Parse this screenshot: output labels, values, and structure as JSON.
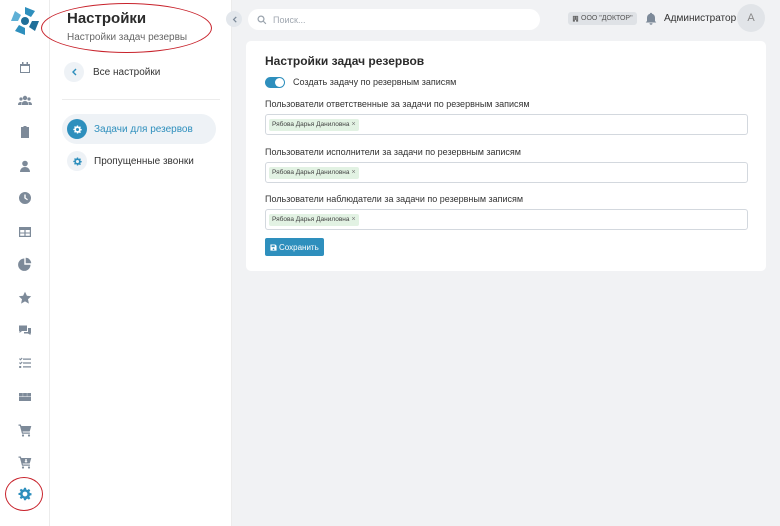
{
  "colors": {
    "accent": "#2e8fbd",
    "annotation": "#c8232c",
    "tag_bg": "#e2f2e3"
  },
  "rail": {
    "icons": [
      "logo-icon",
      "calendar-icon",
      "users-icon",
      "clipboard-icon",
      "user-icon",
      "clock-icon",
      "table-icon",
      "pie-chart-icon",
      "star-icon",
      "chat-icon",
      "checklist-icon",
      "boxes-icon",
      "cart-icon",
      "cart-arrow-icon",
      "gear-icon"
    ],
    "active": "gear-icon"
  },
  "nav": {
    "title": "Настройки",
    "subtitle": "Настройки задач резервы",
    "back_label": "Все настройки",
    "items": [
      {
        "label": "Задачи для резервов",
        "active": true,
        "icon": "gear-icon"
      },
      {
        "label": "Пропущенные звонки",
        "active": false,
        "icon": "gear-icon"
      }
    ]
  },
  "topbar": {
    "search_placeholder": "Поиск...",
    "org_badge": "ООО \"ДОКТОР\"",
    "user_name": "Администратор",
    "avatar_letter": "A"
  },
  "card": {
    "title": "Настройки задач резервов",
    "toggle_label": "Создать задачу по резервным записям",
    "toggle_on": true,
    "fields": [
      {
        "label": "Пользователи ответственные за задачи по резервным записям",
        "tag": "Рябова Дарья Даниловна"
      },
      {
        "label": "Пользователи исполнители за задачи по резервным записям",
        "tag": "Рябова Дарья Даниловна"
      },
      {
        "label": "Пользователи наблюдатели за задачи по резервным записям",
        "tag": "Рябова Дарья Даниловна"
      }
    ],
    "tag_remove": "×",
    "save_label": "Сохранить"
  }
}
